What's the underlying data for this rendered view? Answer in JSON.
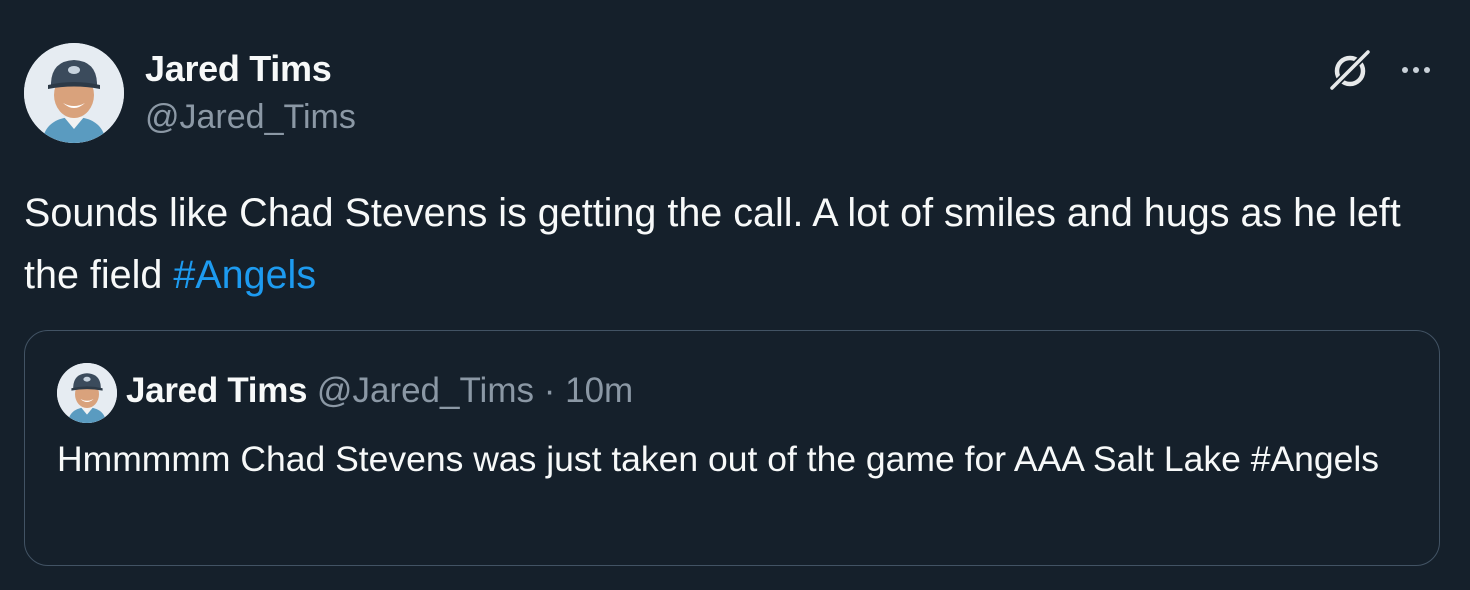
{
  "tweet": {
    "author_name": "Jared Tims",
    "author_handle": "@Jared_Tims",
    "text_main": "Sounds like Chad Stevens is getting the call. A lot of smiles and hugs as he left the field ",
    "hashtag": "#Angels",
    "icons": {
      "grok": "grok-icon",
      "more": "more-options-icon"
    }
  },
  "quote": {
    "author_name": "Jared Tims",
    "author_handle": "@Jared_Tims",
    "separator": "·",
    "time": "10m",
    "text": "Hmmmmm Chad Stevens was just taken out of the game for AAA Salt Lake #Angels"
  },
  "colors": {
    "background": "#15202b",
    "primary_text": "#f7f9f9",
    "secondary_text": "#8b98a5",
    "link": "#1d9bf0",
    "border": "#425364"
  }
}
